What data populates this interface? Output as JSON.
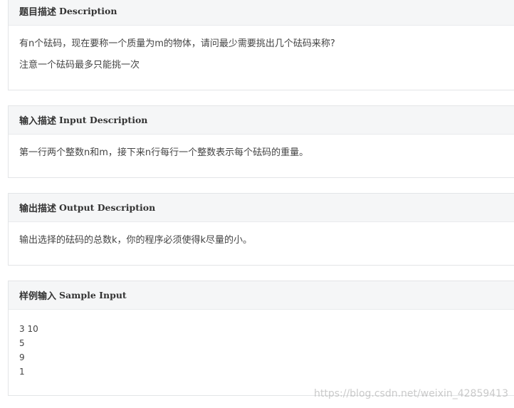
{
  "sections": {
    "description": {
      "title_zh": "题目描述",
      "title_en": "Description",
      "lines": [
        "有n个砝码，现在要称一个质量为m的物体，请问最少需要挑出几个砝码来称?",
        "注意一个砝码最多只能挑一次"
      ]
    },
    "input": {
      "title_zh": "输入描述",
      "title_en": "Input Description",
      "lines": [
        "第一行两个整数n和m，接下来n行每行一个整数表示每个砝码的重量。"
      ]
    },
    "output": {
      "title_zh": "输出描述",
      "title_en": "Output Description",
      "lines": [
        "输出选择的砝码的总数k，你的程序必须使得k尽量的小。"
      ]
    },
    "sample_input": {
      "title_zh": "样例输入",
      "title_en": "Sample Input",
      "lines": [
        "3 10",
        "5",
        "9",
        "1"
      ]
    }
  },
  "watermark": "https://blog.csdn.net/weixin_42859413"
}
